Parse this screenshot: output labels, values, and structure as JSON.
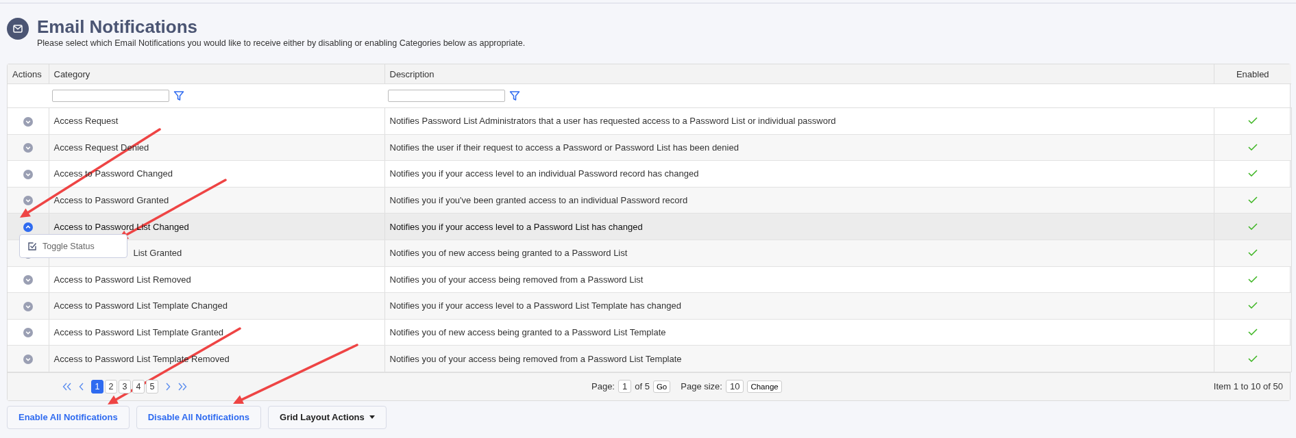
{
  "page": {
    "title": "Email Notifications",
    "subtitle": "Please select which Email Notifications you would like to receive either by disabling or enabling Categories below as appropriate."
  },
  "table": {
    "columns": [
      {
        "label": "Actions",
        "kind": "action"
      },
      {
        "label": "Category",
        "kind": "text"
      },
      {
        "label": "Description",
        "kind": "text"
      },
      {
        "label": "Enabled",
        "kind": "check"
      }
    ],
    "rows": [
      {
        "category": "Access Request",
        "description": "Notifies Password List Administrators that a user has requested access to a Password List or individual password",
        "enabled": true,
        "expanded": false
      },
      {
        "category": "Access Request Denied",
        "description": "Notifies the user if their request to access a Password or Password List has been denied",
        "enabled": true,
        "expanded": false
      },
      {
        "category": "Access to Password Changed",
        "description": "Notifies you if your access level to an individual Password record has changed",
        "enabled": true,
        "expanded": false
      },
      {
        "category": "Access to Password Granted",
        "description": "Notifies you if you've been granted access to an individual Password record",
        "enabled": true,
        "expanded": false
      },
      {
        "category": "Access to Password List Changed",
        "description": "Notifies you if your access level to a Password List has changed",
        "enabled": true,
        "expanded": true,
        "menu": [
          {
            "label": "Toggle Status"
          }
        ]
      },
      {
        "category": "List Granted",
        "description": "Notifies you of new access being granted to a Password List",
        "enabled": true,
        "expanded": false
      },
      {
        "category": "Access to Password List Removed",
        "description": "Notifies you of your access being removed from a Password List",
        "enabled": true,
        "expanded": false
      },
      {
        "category": "Access to Password List Template Changed",
        "description": "Notifies you if your access level to a Password List Template has changed",
        "enabled": true,
        "expanded": false
      },
      {
        "category": "Access to Password List Template Granted",
        "description": "Notifies you of new access being granted to a Password List Template",
        "enabled": true,
        "expanded": false
      },
      {
        "category": "Access to Password List Template Removed",
        "description": "Notifies you of your access being removed from a Password List Template",
        "enabled": true,
        "expanded": false
      }
    ],
    "pager": {
      "pages": [
        {
          "label": "1",
          "selected": true
        },
        {
          "label": "2",
          "selected": false
        },
        {
          "label": "3",
          "selected": false
        },
        {
          "label": "4",
          "selected": false
        },
        {
          "label": "5",
          "selected": false
        }
      ],
      "page_label": "Page:",
      "page_value": "1",
      "of_label": "of 5",
      "go": "Go",
      "size_label": "Page size:",
      "size_value": "10",
      "change": "Change",
      "summary": "Item 1 to 10 of 50"
    }
  },
  "buttons": [
    {
      "label": "Enable All Notifications",
      "kind": "action"
    },
    {
      "label": "Disable All Notifications",
      "kind": "action"
    },
    {
      "label": "Grid Layout Actions",
      "kind": "dropdown"
    }
  ]
}
